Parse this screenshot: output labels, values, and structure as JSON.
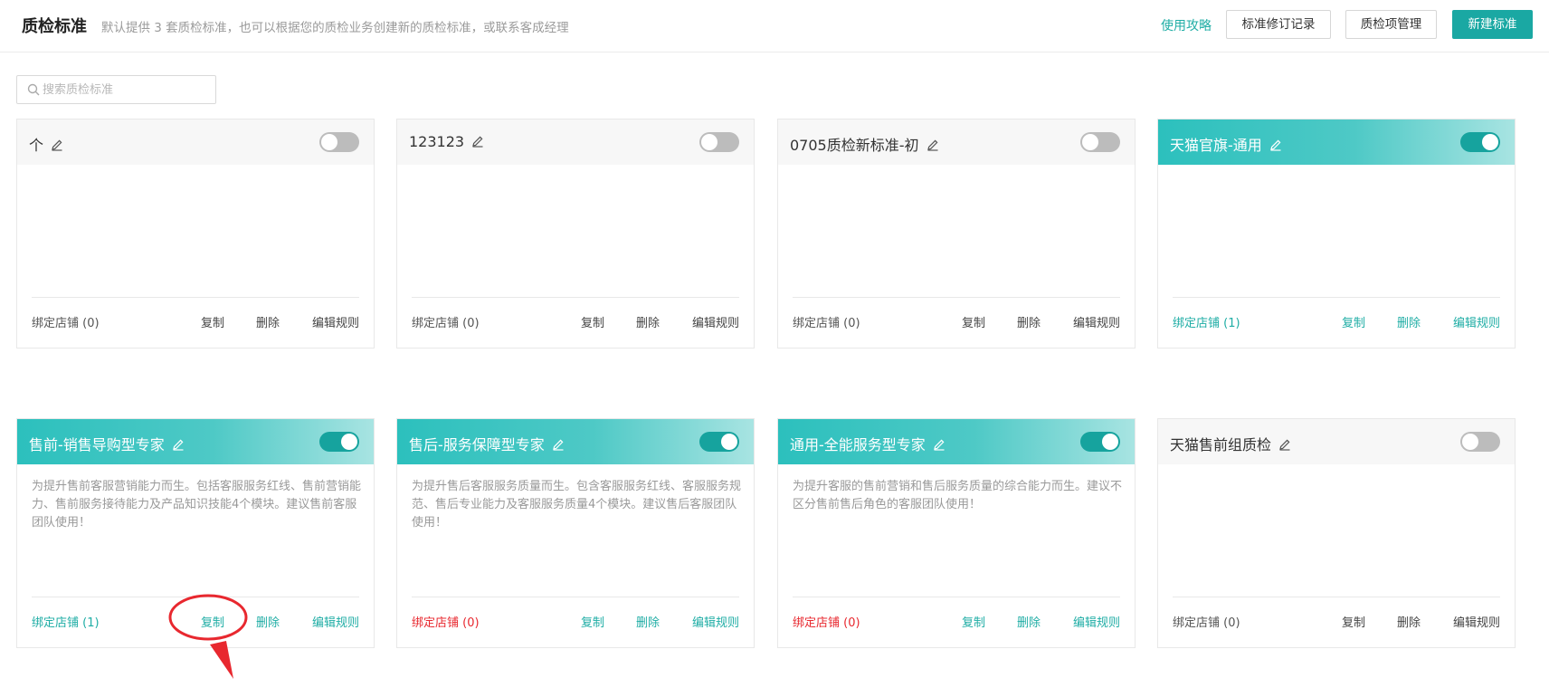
{
  "header": {
    "title": "质检标准",
    "subtitle": "默认提供 3 套质检标准，也可以根据您的质检业务创建新的质检标准，或联系客成经理",
    "guide_link": "使用攻略",
    "buttons": {
      "revision_log": "标准修订记录",
      "item_manage": "质检项管理",
      "new_standard": "新建标准"
    }
  },
  "search": {
    "placeholder": "搜索质检标准",
    "value": ""
  },
  "colors": {
    "accent": "#1aa8a3",
    "danger": "#e8282f",
    "toggle_off": "#bcbcbc"
  },
  "cards": [
    {
      "name": "个",
      "enabled": false,
      "description": "",
      "bind_label": "绑定店铺 (0)",
      "bind_color": "default",
      "copy": "复制",
      "delete": "删除",
      "edit_rules": "编辑规则"
    },
    {
      "name": "123123",
      "enabled": false,
      "description": "",
      "bind_label": "绑定店铺 (0)",
      "bind_color": "default",
      "copy": "复制",
      "delete": "删除",
      "edit_rules": "编辑规则"
    },
    {
      "name": "0705质检新标准-初",
      "enabled": false,
      "description": "",
      "bind_label": "绑定店铺 (0)",
      "bind_color": "default",
      "copy": "复制",
      "delete": "删除",
      "edit_rules": "编辑规则"
    },
    {
      "name": "天猫官旗-通用",
      "enabled": true,
      "description": "",
      "bind_label": "绑定店铺 (1)",
      "bind_color": "teal",
      "copy": "复制",
      "delete": "删除",
      "edit_rules": "编辑规则"
    },
    {
      "name": "售前-销售导购型专家",
      "enabled": true,
      "description": "为提升售前客服营销能力而生。包括客服服务红线、售前营销能力、售前服务接待能力及产品知识技能4个模块。建议售前客服团队使用！",
      "bind_label": "绑定店铺 (1)",
      "bind_color": "teal",
      "copy": "复制",
      "delete": "删除",
      "edit_rules": "编辑规则"
    },
    {
      "name": "售后-服务保障型专家",
      "enabled": true,
      "description": "为提升售后客服服务质量而生。包含客服服务红线、客服服务规范、售后专业能力及客服服务质量4个模块。建议售后客服团队使用！",
      "bind_label": "绑定店铺 (0)",
      "bind_color": "red",
      "copy": "复制",
      "delete": "删除",
      "edit_rules": "编辑规则"
    },
    {
      "name": "通用-全能服务型专家",
      "enabled": true,
      "description": "为提升客服的售前营销和售后服务质量的综合能力而生。建议不区分售前售后角色的客服团队使用！",
      "bind_label": "绑定店铺 (0)",
      "bind_color": "red",
      "copy": "复制",
      "delete": "删除",
      "edit_rules": "编辑规则"
    },
    {
      "name": "天猫售前组质检",
      "enabled": false,
      "description": "",
      "bind_label": "绑定店铺 (0)",
      "bind_color": "default",
      "copy": "复制",
      "delete": "删除",
      "edit_rules": "编辑规则"
    }
  ]
}
